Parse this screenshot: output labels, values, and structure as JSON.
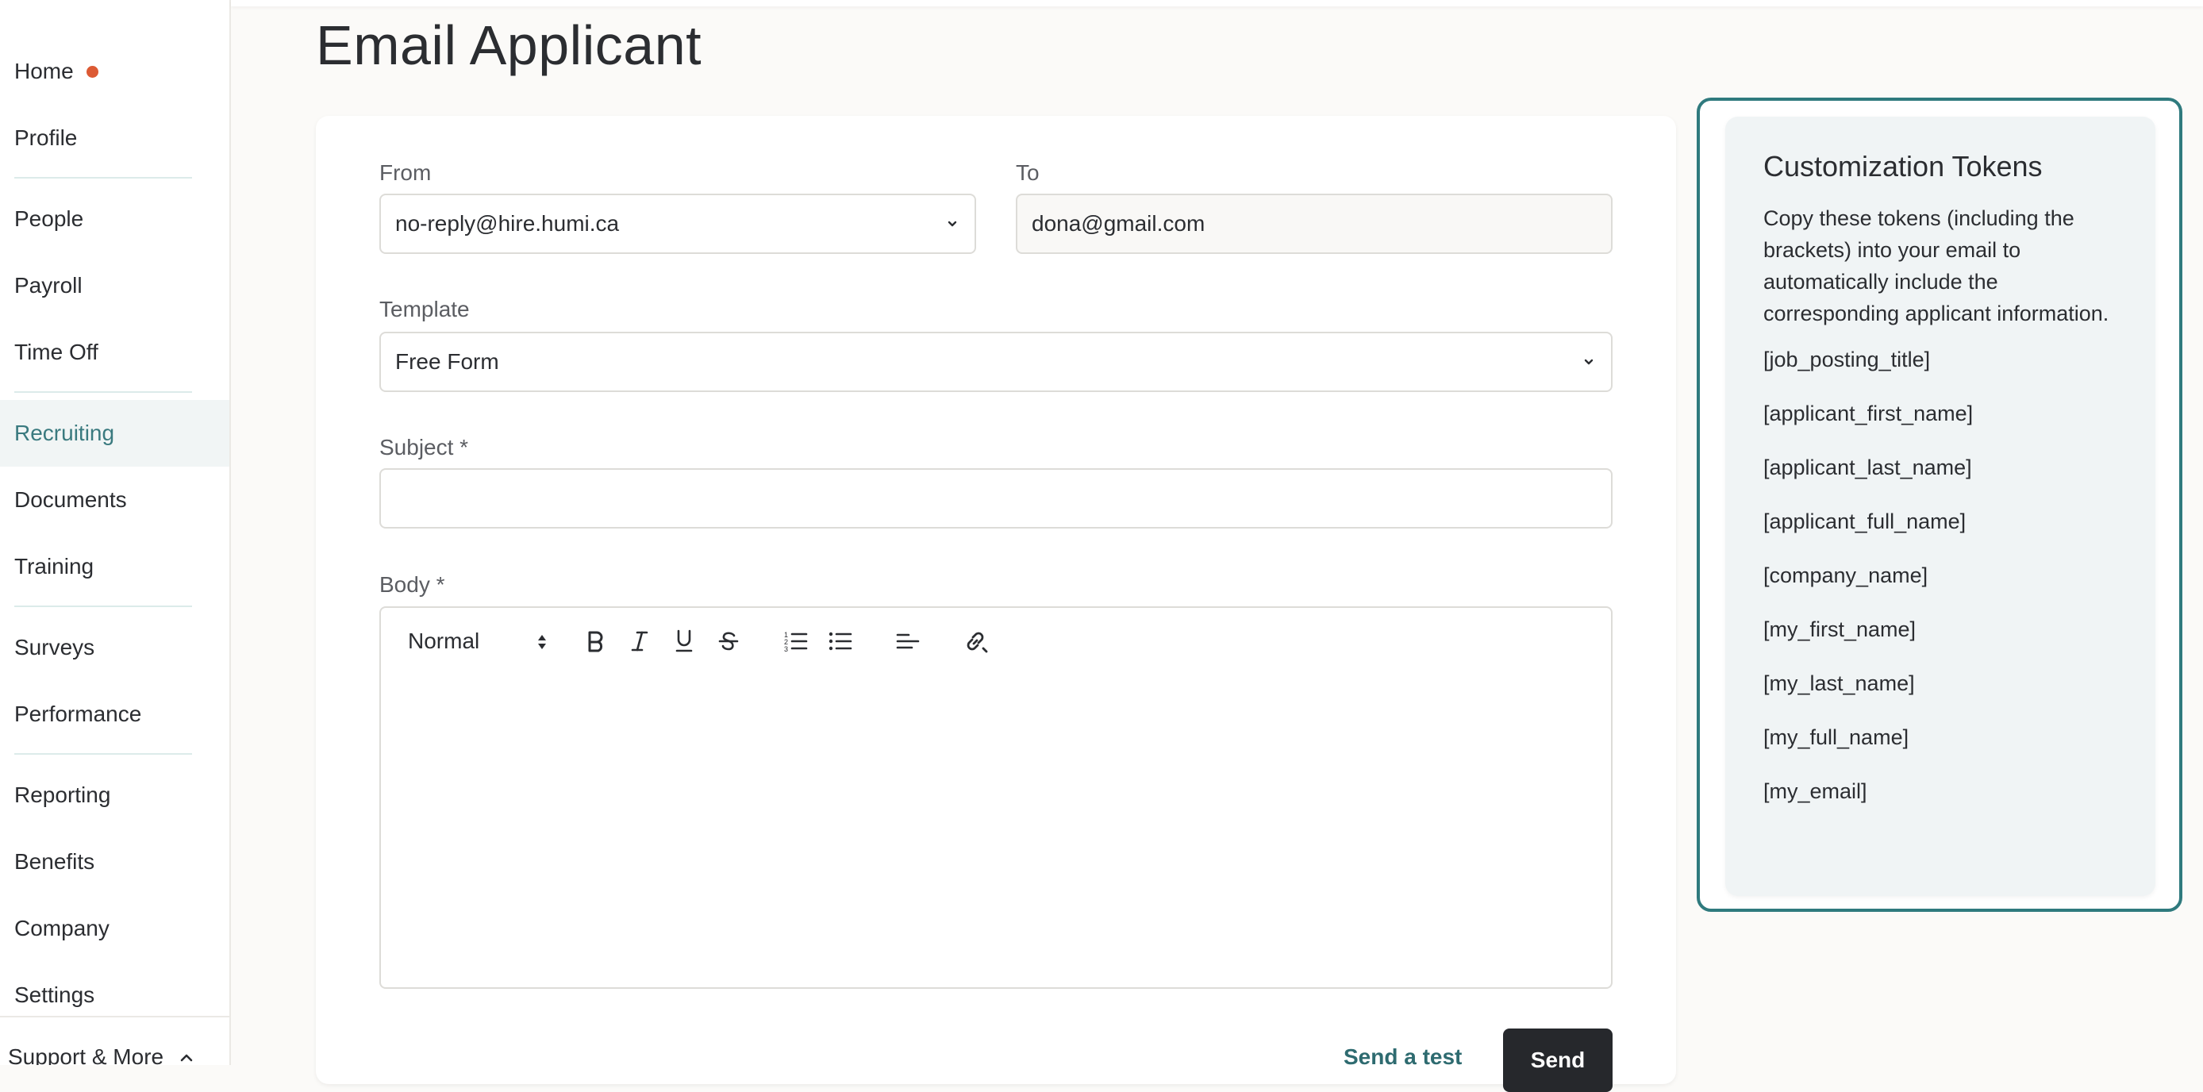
{
  "sidebar": {
    "items": [
      {
        "label": "Home",
        "notification": true
      },
      {
        "label": "Profile"
      },
      {
        "label": "People"
      },
      {
        "label": "Payroll"
      },
      {
        "label": "Time Off"
      },
      {
        "label": "Recruiting",
        "active": true
      },
      {
        "label": "Documents"
      },
      {
        "label": "Training"
      },
      {
        "label": "Surveys"
      },
      {
        "label": "Performance"
      },
      {
        "label": "Reporting"
      },
      {
        "label": "Benefits"
      },
      {
        "label": "Company"
      },
      {
        "label": "Settings"
      }
    ],
    "support_label": "Support & More"
  },
  "page": {
    "title": "Email Applicant"
  },
  "form": {
    "from_label": "From",
    "from_value": "no-reply@hire.humi.ca",
    "to_label": "To",
    "to_value": "dona@gmail.com",
    "template_label": "Template",
    "template_value": "Free Form",
    "subject_label": "Subject *",
    "subject_value": "",
    "body_label": "Body *",
    "body_value": "",
    "toolbar": {
      "heading_value": "Normal",
      "icons": [
        "bold-icon",
        "italic-icon",
        "underline-icon",
        "strikethrough-icon",
        "ordered-list-icon",
        "bullet-list-icon",
        "align-icon",
        "link-icon"
      ]
    },
    "send_test_label": "Send a test",
    "send_label": "Send"
  },
  "tokens": {
    "title": "Customization Tokens",
    "description": "Copy these tokens (including the brackets) into your email to automatically include the corresponding applicant information.",
    "items": [
      "[job_posting_title]",
      "[applicant_first_name]",
      "[applicant_last_name]",
      "[applicant_full_name]",
      "[company_name]",
      "[my_first_name]",
      "[my_last_name]",
      "[my_full_name]",
      "[my_email]"
    ]
  },
  "colors": {
    "accent": "#2f7a7e",
    "notification_dot": "#dc5a34",
    "send_button": "#26282c"
  }
}
